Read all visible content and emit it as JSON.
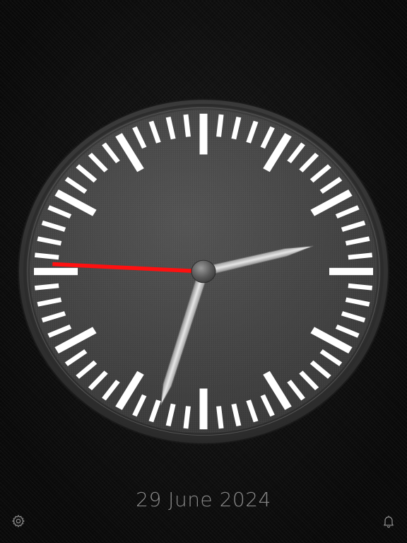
{
  "date": "29 June 2024",
  "clock": {
    "time": {
      "hours": 2,
      "minutes": 32,
      "seconds": 45.5
    },
    "hand_colors": {
      "hour": "#d4d4d4",
      "minute": "#d4d4d4",
      "second": "#ff1010"
    },
    "colors": {
      "face": "#4a4a4a",
      "bezel": "#3a3a3a",
      "ticks": "#ffffff"
    }
  },
  "toolbar": {
    "settings_icon": "gear-icon",
    "alarm_icon": "bell-icon"
  }
}
